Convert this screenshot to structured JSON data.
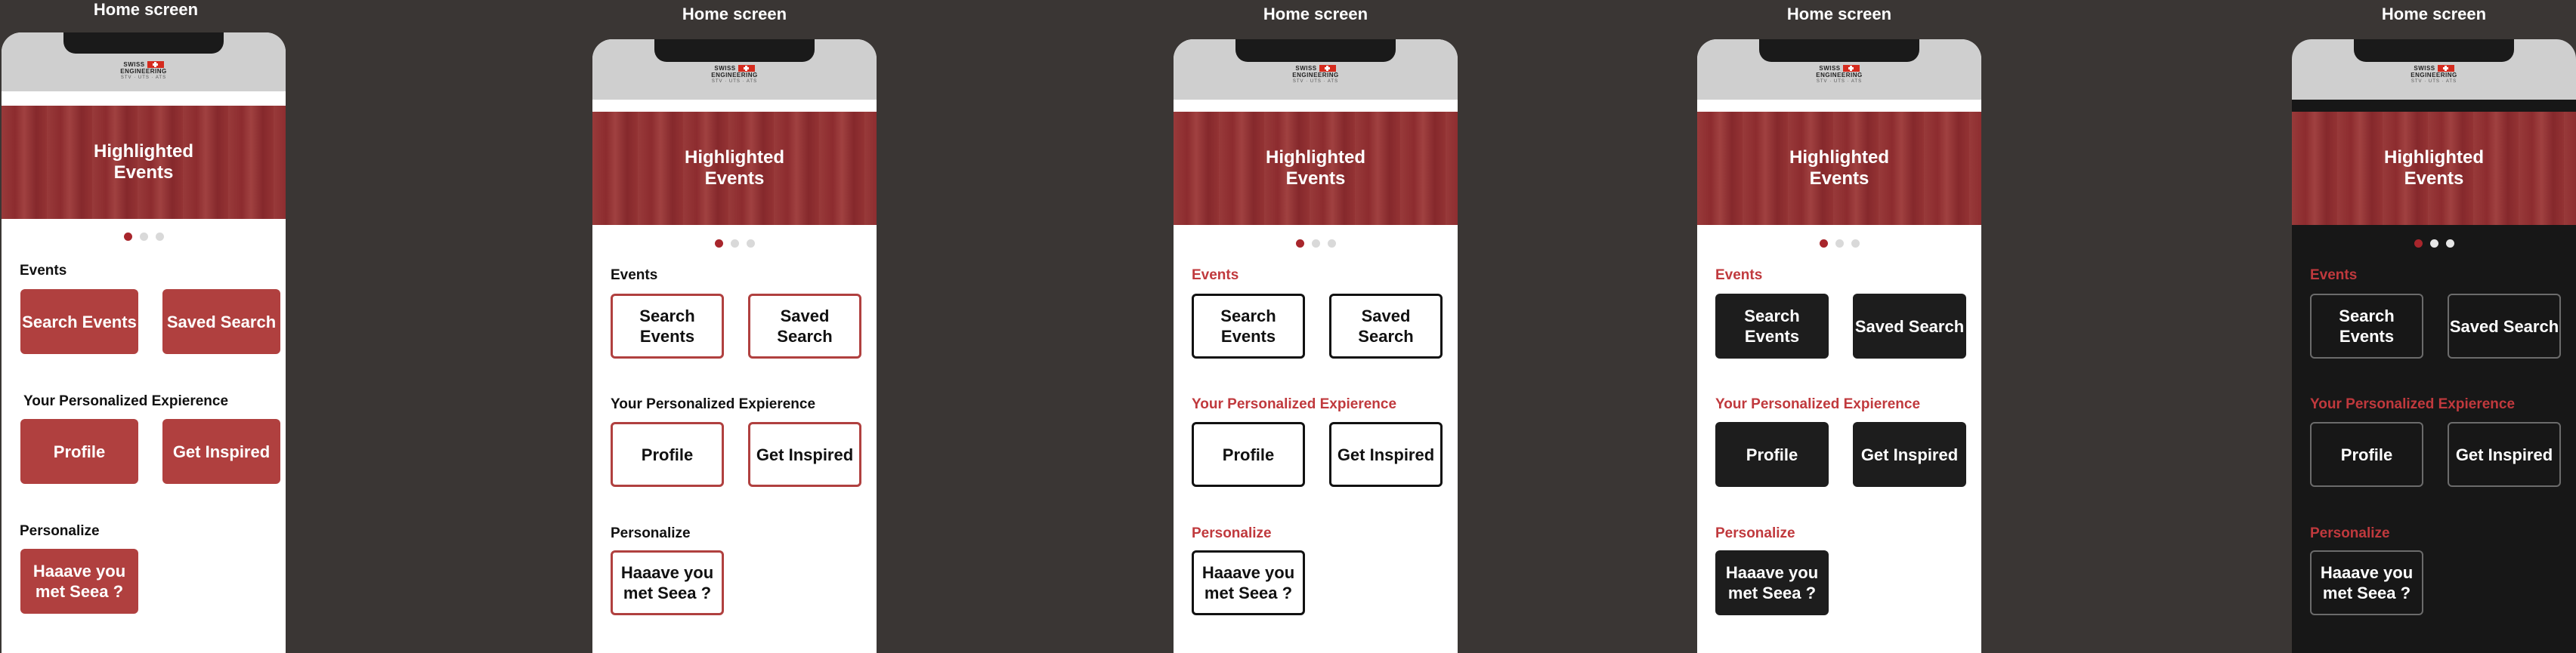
{
  "frames": [
    {
      "title": "Home screen",
      "variant": "v1"
    },
    {
      "title": "Home screen",
      "variant": "v2"
    },
    {
      "title": "Home screen",
      "variant": "v3"
    },
    {
      "title": "Home screen",
      "variant": "v4"
    },
    {
      "title": "Home screen",
      "variant": "v5"
    }
  ],
  "logo": {
    "line1": "SWISS",
    "line2": "ENGINEERING",
    "line3": "STV · UTS · ATS"
  },
  "hero": {
    "title": "Highlighted Events"
  },
  "sections": {
    "events": "Events",
    "personalized": "Your Personalized Expierence",
    "personalize": "Personalize"
  },
  "buttons": {
    "search_events": "Search Events",
    "saved_search": "Saved Search",
    "profile": "Profile",
    "get_inspired": "Get Inspired",
    "seea": "Haaave you met Seea ?"
  },
  "carousel": {
    "page_count": 3,
    "active_index": 0
  },
  "colors": {
    "background": "#3a3634",
    "accent_red": "#b0403f",
    "label_red": "#c0393d",
    "dark_button": "#1d1d1d",
    "dark_screen": "#171717"
  }
}
